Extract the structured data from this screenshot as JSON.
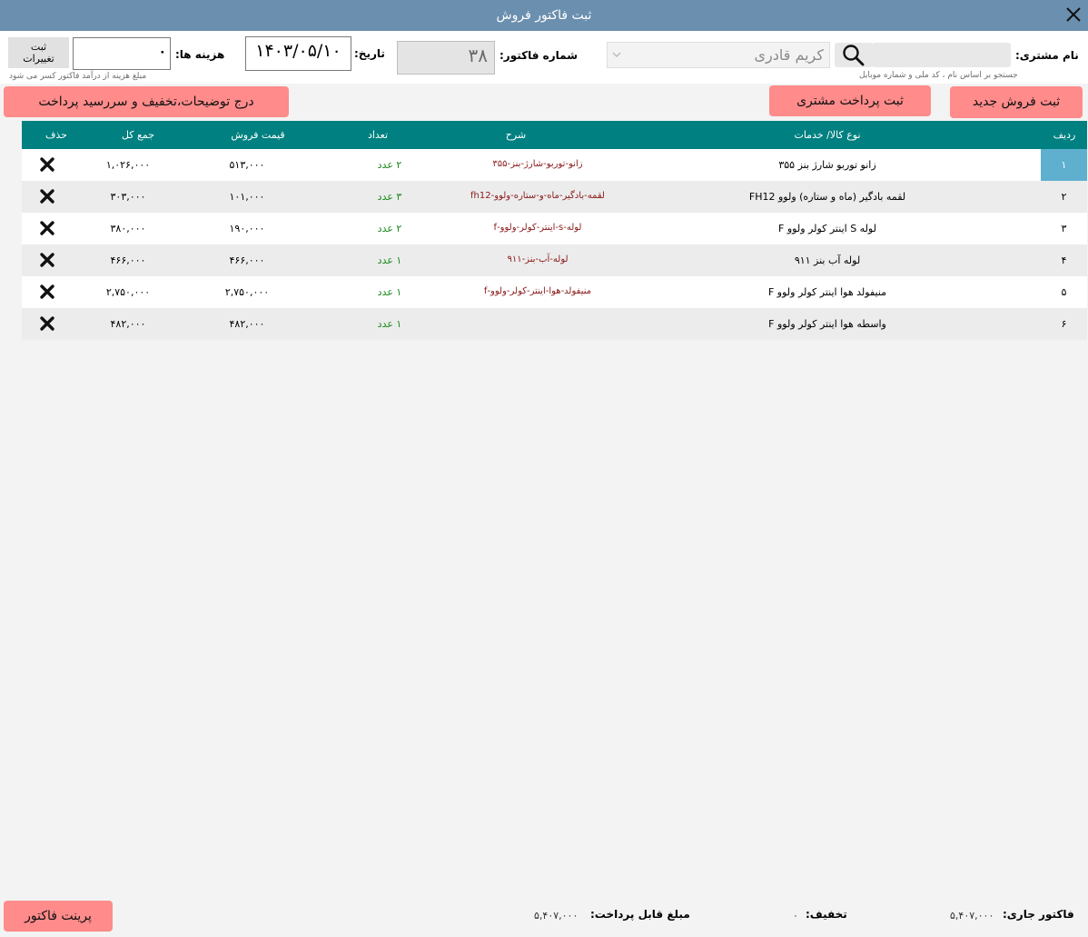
{
  "window": {
    "title": "ثبت فاکتور فروش"
  },
  "customer": {
    "label": "نام مشتری:",
    "search_placeholder": "",
    "hint": "جستجو بر اساس نام ، کد ملی و شماره موبایل",
    "selected": "کریم قادری"
  },
  "invoice": {
    "label": "شماره فاکتور:",
    "number": "۳۸"
  },
  "date": {
    "label": "تاریخ:",
    "value": "۱۴۰۳/۰۵/۱۰"
  },
  "cost": {
    "label": "هزینه ها:",
    "value": "۰",
    "hint": "مبلغ هزینه از درآمد فاکتور کسر می شود"
  },
  "save_changes": {
    "label": "ثبت تغییرات"
  },
  "buttons": {
    "new_sale": "ثبت فروش جدید",
    "customer_payment": "ثبت پرداخت مشتری",
    "notes_discount": "درج توضیحات،تخفیف و سررسید پرداخت",
    "print": "پرینت فاکتور"
  },
  "table": {
    "headers": {
      "row": "ردیف",
      "item": "نوع کالا/ خدمات",
      "desc": "شرح",
      "qty": "تعداد",
      "price": "قیمت فروش",
      "total": "جمع کل",
      "del": "حذف"
    },
    "rows": [
      {
        "row": "۱",
        "item": "زانو توربو شارژ بنز ۳۵۵",
        "desc": "زانو-توربو-شارژ-بنز-۳۵۵",
        "qty": "۲ عدد",
        "price": "۵۱۳,۰۰۰",
        "total": "۱,۰۲۶,۰۰۰"
      },
      {
        "row": "۲",
        "item": "لقمه بادگیر (ماه و ستاره) ولوو FH12",
        "desc": "لقمه-بادگیر-ماه-و-ستاره-ولوو-fh12",
        "qty": "۳ عدد",
        "price": "۱۰۱,۰۰۰",
        "total": "۳۰۳,۰۰۰"
      },
      {
        "row": "۳",
        "item": "لوله S اینتر کولر ولوو F",
        "desc": "لوله-s-اینتر-کولر-ولوو-f",
        "qty": "۲ عدد",
        "price": "۱۹۰,۰۰۰",
        "total": "۳۸۰,۰۰۰"
      },
      {
        "row": "۴",
        "item": "لوله آب بنز ۹۱۱",
        "desc": "لوله-آب-بنز-۹۱۱",
        "qty": "۱ عدد",
        "price": "۴۶۶,۰۰۰",
        "total": "۴۶۶,۰۰۰"
      },
      {
        "row": "۵",
        "item": "منیفولد هوا اینتر کولر ولوو F",
        "desc": "منیفولد-هوا-اینتر-کولر-ولوو-f",
        "qty": "۱ عدد",
        "price": "۲,۷۵۰,۰۰۰",
        "total": "۲,۷۵۰,۰۰۰"
      },
      {
        "row": "۶",
        "item": "واسطه هوا اینتر کولر ولوو F",
        "desc": "",
        "qty": "۱ عدد",
        "price": "۴۸۲,۰۰۰",
        "total": "۴۸۲,۰۰۰"
      }
    ]
  },
  "footer": {
    "current_label": "فاکتور جاری:",
    "current_value": "۵,۴۰۷,۰۰۰",
    "discount_label": "تخفیف:",
    "discount_value": "۰",
    "payable_label": "مبلغ قابل پرداخت:",
    "payable_value": "۵,۴۰۷,۰۰۰"
  },
  "colors": {
    "titlebar": "#6b8fae",
    "grid_header": "#008080",
    "button": "#ff8b8b",
    "selected_row": "#5fb0cf",
    "description_text": "#8b1a1a",
    "quantity_text": "#1a8a1a"
  },
  "icons": {
    "close": "close-icon",
    "search": "search-icon",
    "delete": "delete-x-icon",
    "dropdown": "chevron-down-icon"
  }
}
